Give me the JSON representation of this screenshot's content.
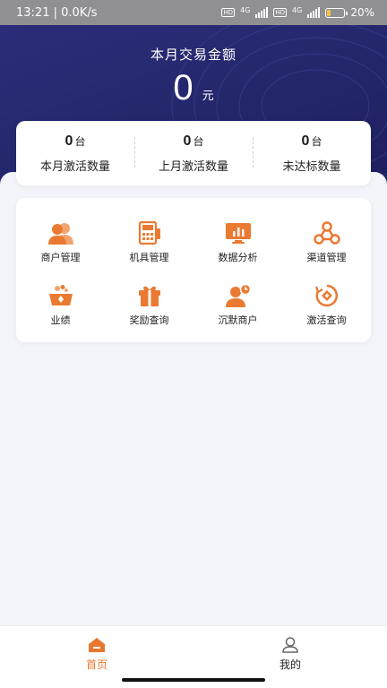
{
  "status_bar": {
    "time": "13:21",
    "speed": "0.0K/s",
    "network1": "4G",
    "network2": "4G",
    "hd1": "HD",
    "hd2": "HD",
    "battery": "20%",
    "battery_level": 0.2,
    "battery_color": "#f5c542"
  },
  "header": {
    "title": "本月交易金额",
    "amount": "0",
    "unit": "元"
  },
  "stats": [
    {
      "value": "0",
      "unit": "台",
      "label": "本月激活数量"
    },
    {
      "value": "0",
      "unit": "台",
      "label": "上月激活数量"
    },
    {
      "value": "0",
      "unit": "台",
      "label": "未达标数量"
    }
  ],
  "menu": {
    "accent_color": "#ea7a31",
    "items": [
      {
        "label": "商户管理",
        "icon": "merchants-icon"
      },
      {
        "label": "机具管理",
        "icon": "pos-terminal-icon"
      },
      {
        "label": "数据分析",
        "icon": "data-chart-icon"
      },
      {
        "label": "渠道管理",
        "icon": "channel-network-icon"
      },
      {
        "label": "业绩",
        "icon": "performance-basket-icon"
      },
      {
        "label": "奖励查询",
        "icon": "gift-icon"
      },
      {
        "label": "沉默商户",
        "icon": "silent-merchant-icon"
      },
      {
        "label": "激活查询",
        "icon": "activation-query-icon"
      }
    ]
  },
  "bottom_nav": {
    "active_color": "#e8772e",
    "items": [
      {
        "label": "首页",
        "icon": "home-icon",
        "active": true
      },
      {
        "label": "我的",
        "icon": "profile-icon",
        "active": false
      }
    ]
  }
}
